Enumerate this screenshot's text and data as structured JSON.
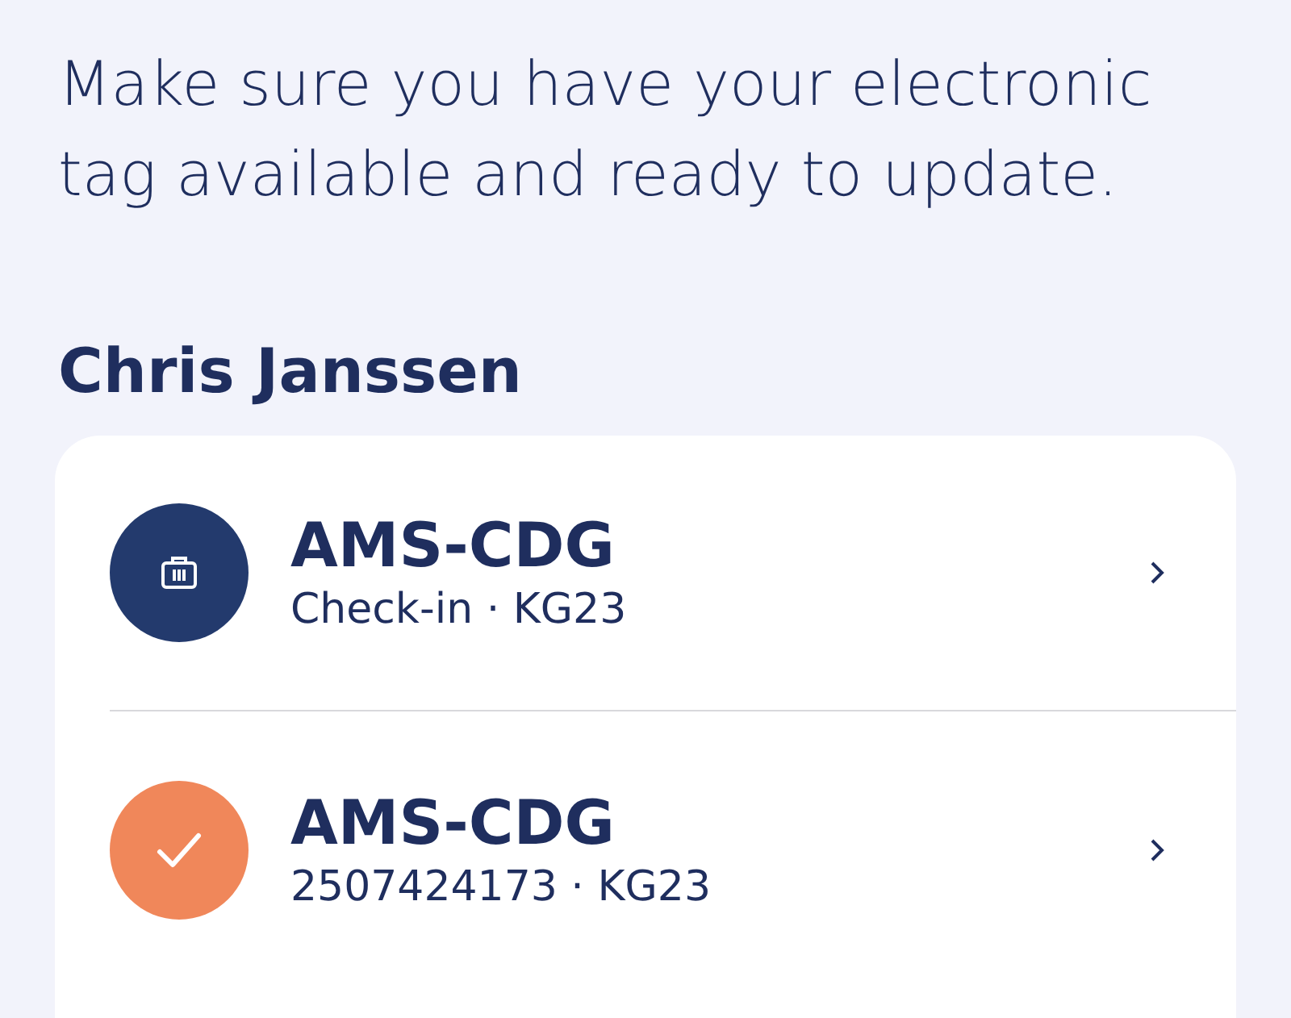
{
  "intro": "Make sure you have your electronic tag available and ready to update.",
  "passenger": {
    "name": "Chris Janssen"
  },
  "trips": [
    {
      "kind": "checkin",
      "route": "AMS-CDG",
      "detail": "Check-in · KG23"
    },
    {
      "kind": "done",
      "route": "AMS-CDG",
      "detail": "2507424173 · KG23"
    }
  ]
}
